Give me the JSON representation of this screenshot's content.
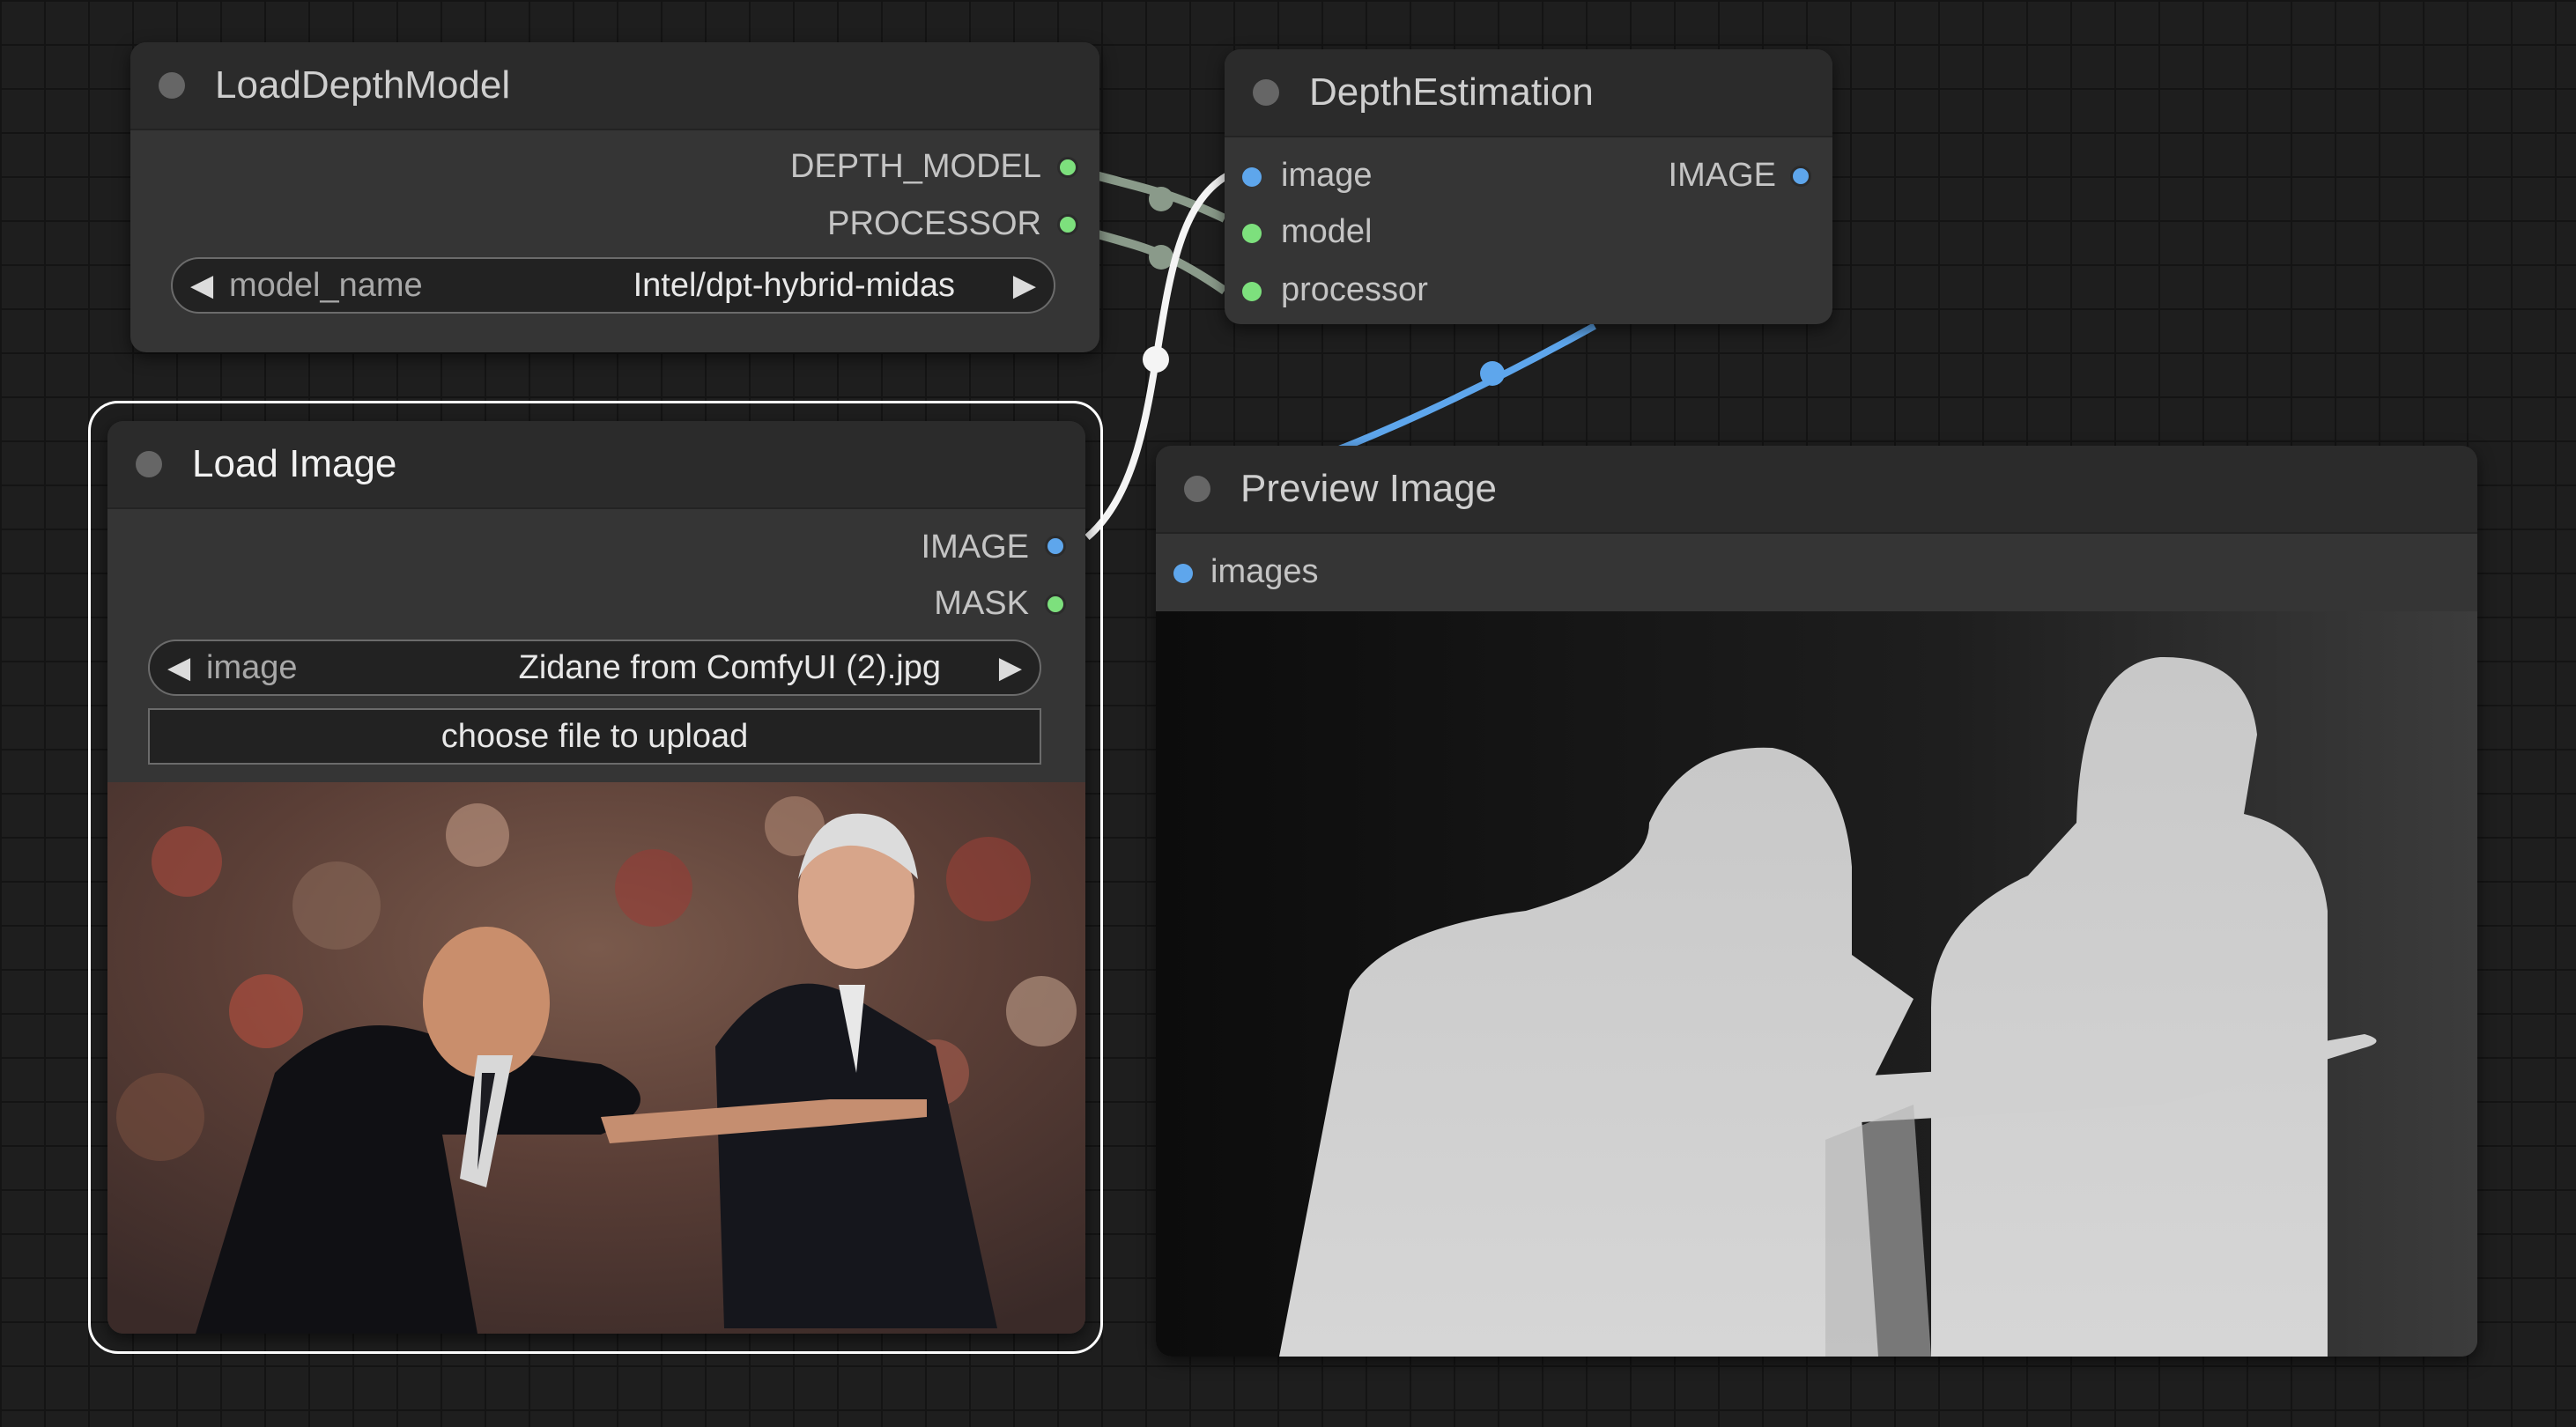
{
  "nodes": {
    "load_depth_model": {
      "title": "LoadDepthModel",
      "outputs": [
        "DEPTH_MODEL",
        "PROCESSOR"
      ],
      "widget": {
        "name": "model_name",
        "value": "Intel/dpt-hybrid-midas"
      }
    },
    "depth_estimation": {
      "title": "DepthEstimation",
      "inputs": [
        "image",
        "model",
        "processor"
      ],
      "outputs": [
        "IMAGE"
      ]
    },
    "load_image": {
      "title": "Load Image",
      "outputs": [
        "IMAGE",
        "MASK"
      ],
      "widget": {
        "name": "image",
        "value": "Zidane from ComfyUI (2).jpg"
      },
      "upload_button": "choose file to upload"
    },
    "preview_image": {
      "title": "Preview Image",
      "inputs": [
        "images"
      ]
    }
  },
  "colors": {
    "canvas_bg": "#1e1e1e",
    "node_bg": "#353535",
    "node_title_bg": "#2b2b2b",
    "slot_model": "#7de07d",
    "slot_image": "#5ea6ec",
    "link_image": "#5ea6ec",
    "link_model": "#8a9a8a",
    "selection_outline": "#ffffff"
  },
  "icons": {
    "combo_left": "◀",
    "combo_right": "▶"
  }
}
